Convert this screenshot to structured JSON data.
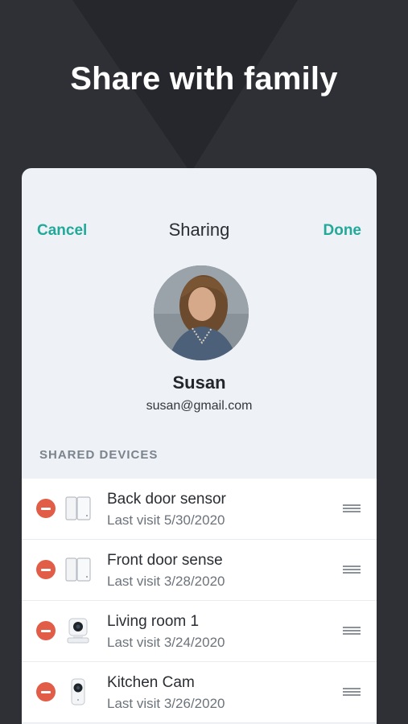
{
  "headline": "Share with family",
  "nav": {
    "cancel_label": "Cancel",
    "title": "Sharing",
    "done_label": "Done"
  },
  "user": {
    "name": "Susan",
    "email": "susan@gmail.com"
  },
  "section_title": "SHARED DEVICES",
  "devices": [
    {
      "name": "Back door sensor",
      "visit": "Last visit 5/30/2020",
      "icon": "contact-sensor-icon"
    },
    {
      "name": "Front door sense",
      "visit": "Last visit 3/28/2020",
      "icon": "contact-sensor-icon"
    },
    {
      "name": "Living room 1",
      "visit": "Last visit 3/24/2020",
      "icon": "cam-pan-icon"
    },
    {
      "name": "Kitchen Cam",
      "visit": "Last visit 3/26/2020",
      "icon": "cam-icon"
    }
  ],
  "colors": {
    "accent": "#22a99a",
    "remove": "#e25d47",
    "background": "#2e3036",
    "card": "#eef1f5"
  }
}
